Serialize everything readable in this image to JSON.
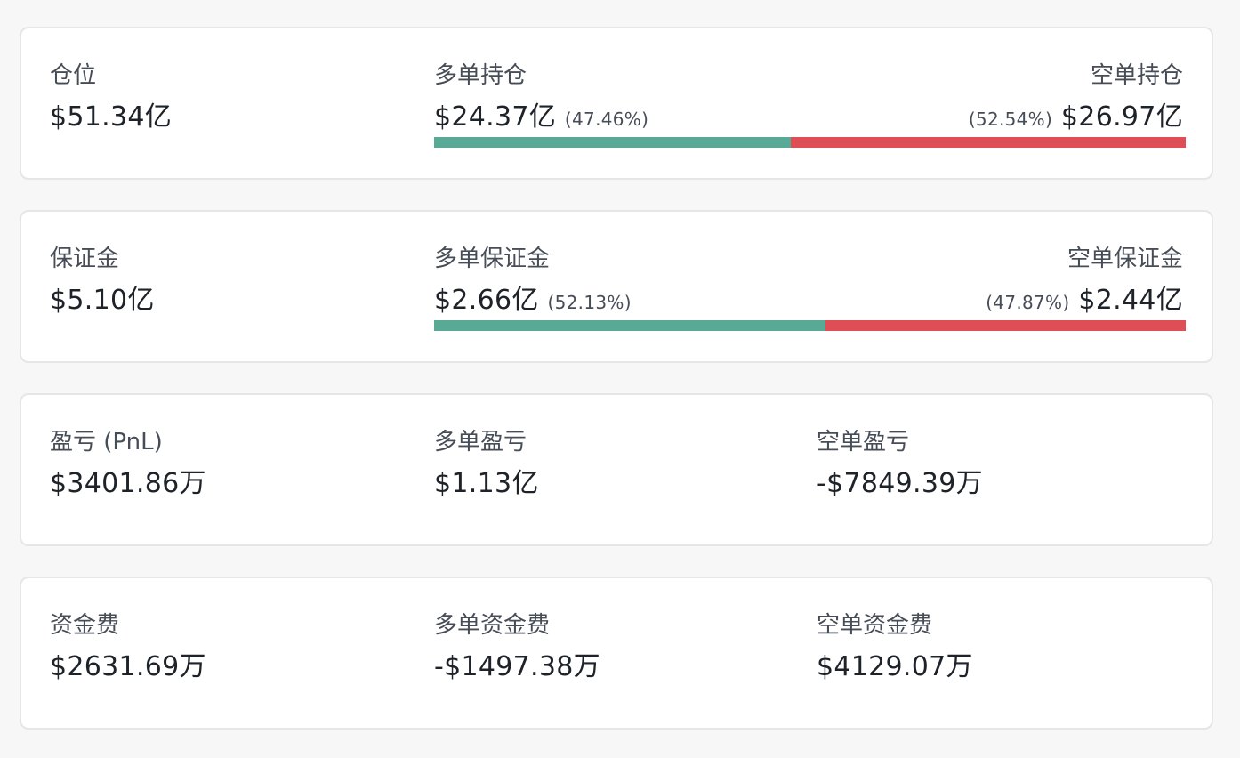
{
  "colors": {
    "long": "#58a996",
    "short": "#e04e55"
  },
  "position": {
    "label": "仓位",
    "value": "$51.34亿",
    "long_label": "多单持仓",
    "long_value": "$24.37亿",
    "long_pct": "(47.46%)",
    "long_ratio": 0.4746,
    "short_label": "空单持仓",
    "short_value": "$26.97亿",
    "short_pct": "(52.54%)"
  },
  "margin": {
    "label": "保证金",
    "value": "$5.10亿",
    "long_label": "多单保证金",
    "long_value": "$2.66亿",
    "long_pct": "(52.13%)",
    "long_ratio": 0.5213,
    "short_label": "空单保证金",
    "short_value": "$2.44亿",
    "short_pct": "(47.87%)"
  },
  "pnl": {
    "label": "盈亏 (PnL)",
    "value": "$3401.86万",
    "long_label": "多单盈亏",
    "long_value": "$1.13亿",
    "short_label": "空单盈亏",
    "short_value": "-$7849.39万"
  },
  "funding": {
    "label": "资金费",
    "value": "$2631.69万",
    "long_label": "多单资金费",
    "long_value": "-$1497.38万",
    "short_label": "空单资金费",
    "short_value": "$4129.07万"
  }
}
